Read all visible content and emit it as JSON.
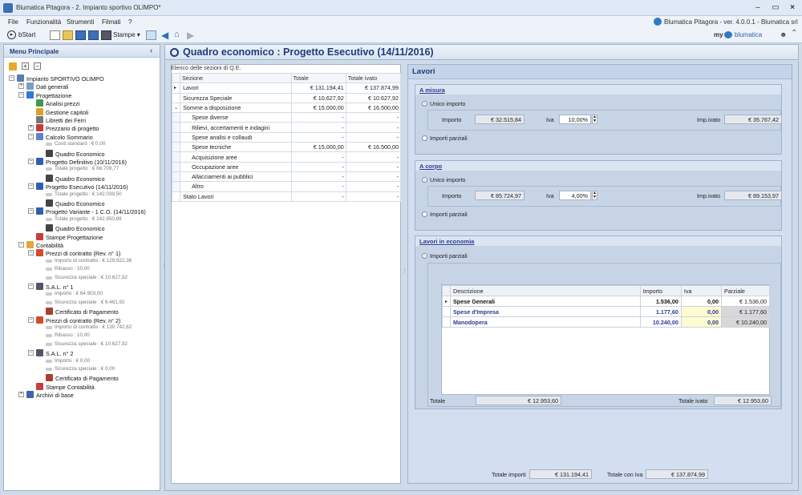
{
  "window": {
    "title": "Blumatica Pitagora - 2. Impianto sportivo OLIMPO*",
    "app_info": "Blumatica Pitagora - ver. 4.0.0.1 - Blumatica srl"
  },
  "menu": [
    "File",
    "Funzionalità",
    "Strumenti",
    "Filmati",
    "?"
  ],
  "toolbar": {
    "bstart": "bStart",
    "stampe": "Stampe",
    "brand_my": "my",
    "brand_name": "blumatica"
  },
  "sidebar": {
    "title": "Menu Principale",
    "tree": [
      {
        "label": "Impianto SPORTIVO OLIMPO",
        "level": 0,
        "icon": "building-icon",
        "expander": "-"
      },
      {
        "label": "Dati generali",
        "level": 1,
        "icon": "document-icon",
        "expander": "+"
      },
      {
        "label": "Progettazione",
        "level": 1,
        "icon": "ruler-icon",
        "expander": "-"
      },
      {
        "label": "Analisi prezzi",
        "level": 2,
        "icon": "chart-icon"
      },
      {
        "label": "Gestione capitoli",
        "level": 2,
        "icon": "folder-icon"
      },
      {
        "label": "Libretti dei Ferri",
        "level": 2,
        "icon": "book-icon"
      },
      {
        "label": "Prezzario di progetto",
        "level": 2,
        "icon": "price-icon",
        "expander": "+"
      },
      {
        "label": "Calcolo Sommario",
        "level": 2,
        "icon": "calc-icon",
        "expander": "-"
      },
      {
        "label": "Costi standard  : € 0,00",
        "level": 3,
        "small": true
      },
      {
        "label": "Quadro Economico",
        "level": 3,
        "icon": "qe-icon"
      },
      {
        "label": "Progetto Definitivo (10/11/2016)",
        "level": 2,
        "icon": "project-icon",
        "expander": "-"
      },
      {
        "label": "Totale progetto  : € 66.709,77",
        "level": 3,
        "small": true
      },
      {
        "label": "Quadro Economico",
        "level": 3,
        "icon": "qe-icon"
      },
      {
        "label": "Progetto Esecutivo (14/11/2016)",
        "level": 2,
        "icon": "project-icon",
        "expander": "-"
      },
      {
        "label": "Totale progetto  : € 142.039,50",
        "level": 3,
        "small": true
      },
      {
        "label": "Quadro Economico",
        "level": 3,
        "icon": "qe-icon"
      },
      {
        "label": "Progetto Variante - 1 C.O. (14/11/2016)",
        "level": 2,
        "icon": "project-icon",
        "expander": "-"
      },
      {
        "label": "Totale progetto  : € 142.950,89",
        "level": 3,
        "small": true
      },
      {
        "label": "Quadro Economico",
        "level": 3,
        "icon": "qe-icon"
      },
      {
        "label": "Stampe Progettazione",
        "level": 2,
        "icon": "print-icon"
      },
      {
        "label": "Contabilità",
        "level": 1,
        "icon": "accounting-icon",
        "expander": "-"
      },
      {
        "label": "Prezzi di contratto (Rev. n° 1)",
        "level": 2,
        "icon": "euro-icon",
        "expander": "-"
      },
      {
        "label": "Importo di contratto  : € 129.922,36",
        "level": 3,
        "small": true
      },
      {
        "label": "Ribasso  : 10,00",
        "level": 3,
        "small": true
      },
      {
        "label": "Sicurezza speciale  : € 10.627,92",
        "level": 3,
        "small": true
      },
      {
        "label": "S.A.L. n° 1",
        "level": 2,
        "icon": "sal-icon",
        "expander": "-"
      },
      {
        "label": "Importo  : € 64.903,00",
        "level": 3,
        "small": true
      },
      {
        "label": "Sicurezza speciale  : € 6.461,92",
        "level": 3,
        "small": true
      },
      {
        "label": "Certificato di Pagamento",
        "level": 3,
        "icon": "certificate-icon"
      },
      {
        "label": "Prezzi di contratto (Rev. n° 2)",
        "level": 2,
        "icon": "euro-icon",
        "expander": "-"
      },
      {
        "label": "Importo di contratto  : € 130.742,62",
        "level": 3,
        "small": true
      },
      {
        "label": "Ribasso  : 10,00",
        "level": 3,
        "small": true
      },
      {
        "label": "Sicurezza speciale  : € 10.627,92",
        "level": 3,
        "small": true
      },
      {
        "label": "S.A.L. n° 2",
        "level": 2,
        "icon": "sal-icon",
        "expander": "-"
      },
      {
        "label": "Importo  : € 0,00",
        "level": 3,
        "small": true
      },
      {
        "label": "Sicurezza speciale  : € 0,00",
        "level": 3,
        "small": true
      },
      {
        "label": "Certificato di Pagamento",
        "level": 3,
        "icon": "certificate-icon"
      },
      {
        "label": "Stampe Contabilità",
        "level": 2,
        "icon": "print-icon"
      },
      {
        "label": "Archivi di base",
        "level": 1,
        "icon": "archive-icon",
        "expander": "+"
      }
    ]
  },
  "main": {
    "title": "Quadro economico : Progetto Esecutivo (14/11/2016)",
    "qe_caption": "Elenco delle sezioni di Q.E.",
    "qe_headers": [
      "Sezione",
      "Totale",
      "Totale ivato"
    ],
    "qe_rows": [
      {
        "sezione": "Lavori",
        "totale": "€ 131.194,41",
        "ivato": "€ 137.874,99",
        "indent": 0,
        "selected": true
      },
      {
        "sezione": "Sicurezza Speciale",
        "totale": "€ 10.627,92",
        "ivato": "€ 10.627,92",
        "indent": 0
      },
      {
        "sezione": "Somme a disposizione",
        "totale": "€ 15.000,00",
        "ivato": "€ 16.500,00",
        "indent": 0,
        "expander": "v"
      },
      {
        "sezione": "Spese diverse",
        "totale": "-",
        "ivato": "-",
        "indent": 1
      },
      {
        "sezione": "Rilievi, accertamenti e indagini",
        "totale": "-",
        "ivato": "-",
        "indent": 1
      },
      {
        "sezione": "Spese analisi e collaudi",
        "totale": "-",
        "ivato": "-",
        "indent": 1
      },
      {
        "sezione": "Spese tecniche",
        "totale": "€ 15.000,00",
        "ivato": "€ 16.500,00",
        "indent": 1
      },
      {
        "sezione": "Acquisizione aree",
        "totale": "-",
        "ivato": "-",
        "indent": 1
      },
      {
        "sezione": "Occupazione aree",
        "totale": "-",
        "ivato": "-",
        "indent": 1
      },
      {
        "sezione": "Allacciamenti ai pubblici",
        "totale": "-",
        "ivato": "-",
        "indent": 1
      },
      {
        "sezione": "Altro",
        "totale": "-",
        "ivato": "-",
        "indent": 1
      },
      {
        "sezione": "Stato Lavori",
        "totale": "-",
        "ivato": "-",
        "indent": 0
      }
    ],
    "lavori": {
      "title": "Lavori",
      "a_misura": {
        "title": "A misura",
        "unico": "Unico importo",
        "importo_label": "Importo",
        "importo": "€ 32.515,84",
        "iva_label": "Iva",
        "iva": "10,00%",
        "impivato_label": "Imp.ivato",
        "impivato": "€ 35.767,42",
        "parziali": "Importi parziali"
      },
      "a_corpo": {
        "title": "A corpo",
        "unico": "Unico importo",
        "importo_label": "Importo",
        "importo": "€ 85.724,97",
        "iva_label": "Iva",
        "iva": "4,00%",
        "impivato_label": "Imp.ivato",
        "impivato": "€ 89.153,97",
        "parziali": "Importi parziali"
      },
      "economia": {
        "title": "Lavori in economia",
        "parziali": "Importi parziali",
        "headers": [
          "Descrizione",
          "Importo",
          "Iva",
          "Parziale"
        ],
        "rows": [
          {
            "descrizione": "Spese Generali",
            "importo": "1.536,00",
            "iva": "0,00",
            "parziale": "€ 1.536,00"
          },
          {
            "descrizione": "Spese d'Impresa",
            "importo": "1.177,60",
            "iva": "0,00",
            "parziale": "€ 1.177,60"
          },
          {
            "descrizione": "Manodopera",
            "importo": "10.240,00",
            "iva": "0,00",
            "parziale": "€ 10.240,00"
          }
        ],
        "totale_label": "Totale",
        "totale": "€ 12.953,60",
        "totale_ivato_label": "Totale ivato",
        "totale_ivato": "€ 12.953,60"
      },
      "totale_importi_label": "Totale importi",
      "totale_importi": "€ 131.194,41",
      "totale_iva_label": "Totale con Iva",
      "totale_iva": "€ 137.874,99"
    }
  },
  "colors": {
    "accent": "#2a3a90",
    "title_blue": "#1f3c7a",
    "selected_row": "#fffbd0"
  }
}
